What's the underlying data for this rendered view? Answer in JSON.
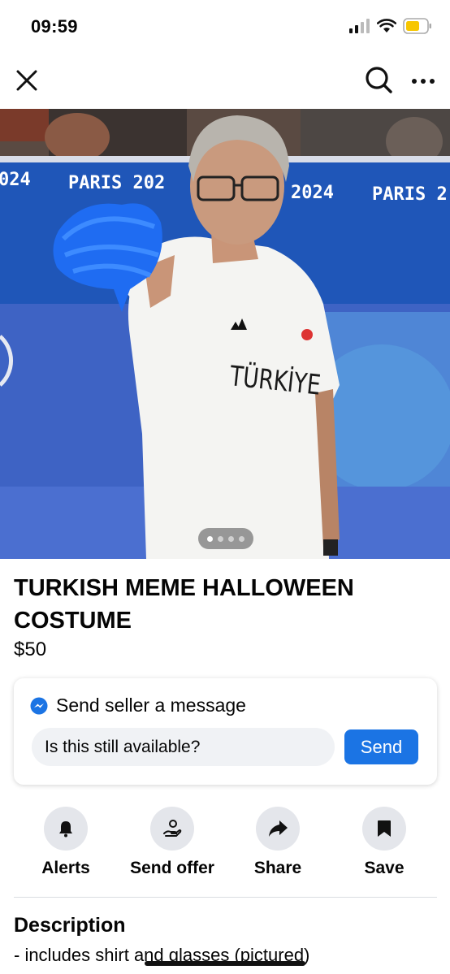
{
  "status_bar": {
    "time": "09:59",
    "icons": [
      "cellular-signal-icon",
      "wifi-icon",
      "battery-icon"
    ],
    "battery_color": "#f7c600"
  },
  "nav": {
    "icons": [
      "close-icon",
      "search-icon",
      "more-icon"
    ]
  },
  "photo": {
    "banner_text": [
      "024",
      "PARIS 202",
      "2024",
      "PARIS 2"
    ],
    "shirt_text": "TÜRKİYE",
    "carousel_count": 4,
    "carousel_active": 0
  },
  "listing": {
    "title": "TURKISH MEME HALLOWEEN COSTUME",
    "price": "$50"
  },
  "message": {
    "header": "Send seller a message",
    "input_value": "Is this still available?",
    "send_label": "Send",
    "accent": "#1b74e4"
  },
  "actions": [
    {
      "label": "Alerts",
      "icon": "bell-icon"
    },
    {
      "label": "Send offer",
      "icon": "offer-icon"
    },
    {
      "label": "Share",
      "icon": "share-icon"
    },
    {
      "label": "Save",
      "icon": "bookmark-icon"
    }
  ],
  "description": {
    "heading": "Description",
    "text": "- includes shirt and glasses (pictured)"
  }
}
